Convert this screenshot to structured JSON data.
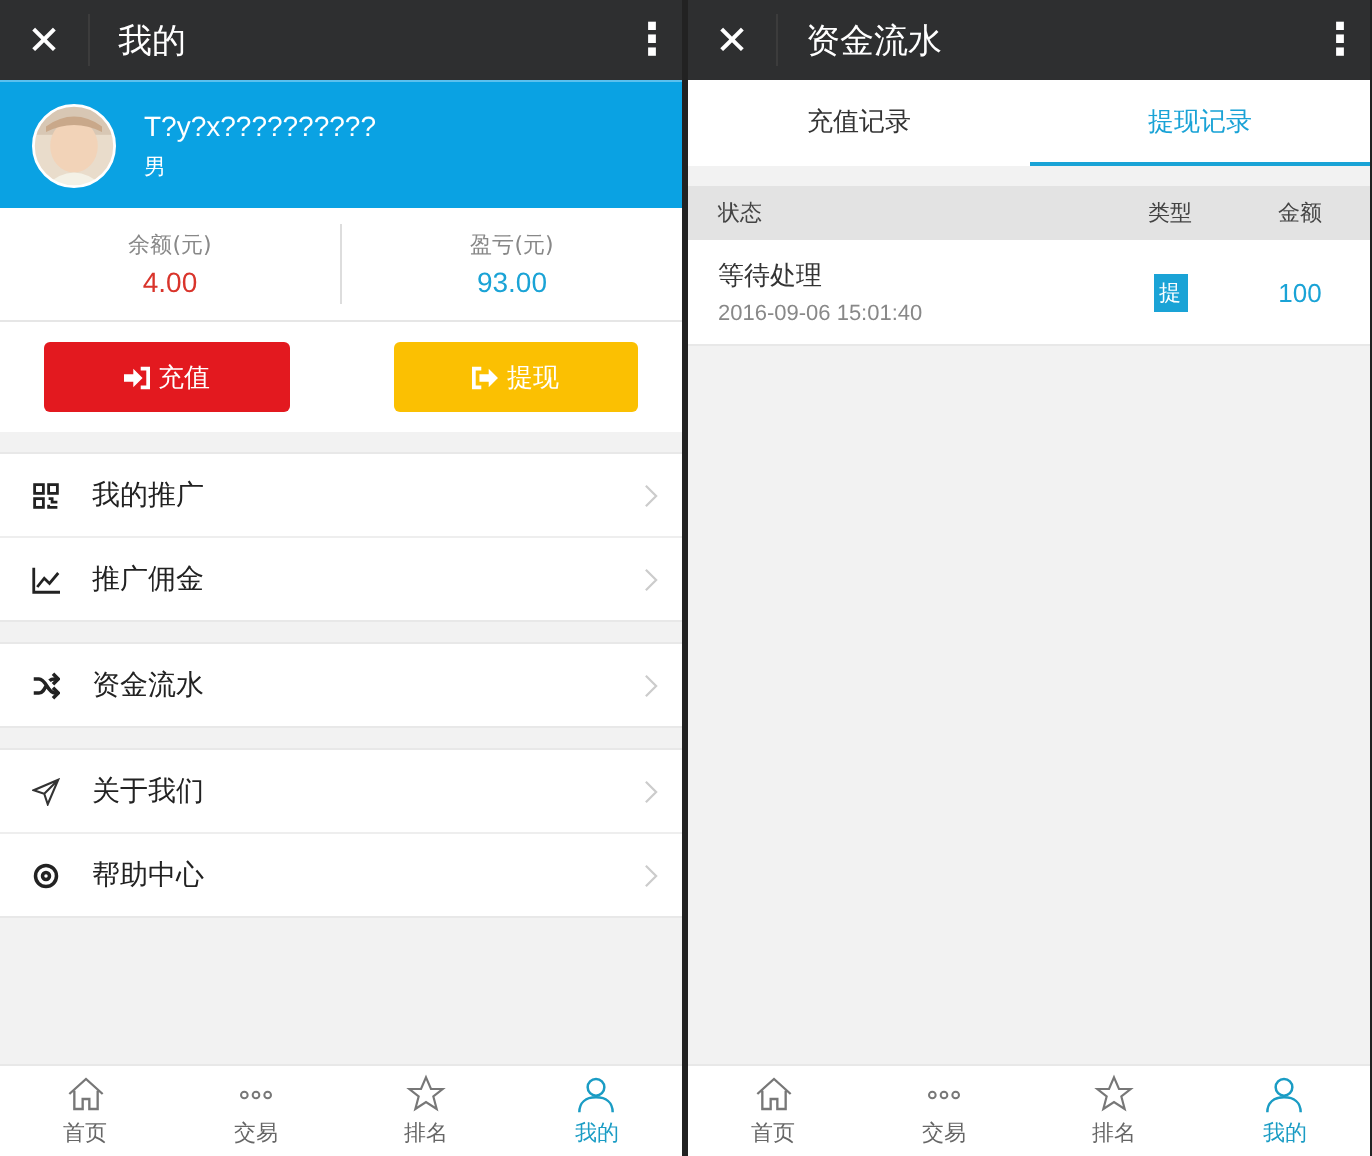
{
  "profile_screen": {
    "header": {
      "close": "✕",
      "title": "我的",
      "more": "⋮"
    },
    "user": {
      "name": "T?y?x??????????",
      "gender": "男"
    },
    "stats": [
      {
        "label": "余额(元)",
        "value": "4.00",
        "color": "#d9342b"
      },
      {
        "label": "盈亏(元)",
        "value": "93.00",
        "color": "#1aa3d6"
      }
    ],
    "buttons": [
      {
        "label": "充值",
        "kind": "deposit"
      },
      {
        "label": "提现",
        "kind": "withdraw"
      }
    ],
    "menu_groups": [
      [
        {
          "label": "我的推广",
          "kind": "qr"
        },
        {
          "label": "推广佣金",
          "kind": "chart"
        }
      ],
      [
        {
          "label": "资金流水",
          "kind": "shuffle"
        }
      ],
      [
        {
          "label": "关于我们",
          "kind": "send"
        },
        {
          "label": "帮助中心",
          "kind": "help"
        }
      ]
    ],
    "tabbar": [
      {
        "label": "首页",
        "kind": "home",
        "selected": false
      },
      {
        "label": "交易",
        "kind": "dots",
        "selected": false
      },
      {
        "label": "排名",
        "kind": "star",
        "selected": false
      },
      {
        "label": "我的",
        "kind": "user",
        "selected": true
      }
    ]
  },
  "funds_screen": {
    "header": {
      "close": "✕",
      "title": "资金流水",
      "more": "⋮"
    },
    "tabs": [
      {
        "label": "充值记录",
        "selected": false
      },
      {
        "label": "提现记录",
        "selected": true
      }
    ],
    "table": {
      "columns": [
        "状态",
        "类型",
        "金额"
      ],
      "rows": [
        {
          "status": "等待处理",
          "time": "2016-09-06 15:01:40",
          "type": "提",
          "amount": "100"
        }
      ]
    },
    "tabbar": [
      {
        "label": "首页",
        "kind": "home",
        "selected": false
      },
      {
        "label": "交易",
        "kind": "dots",
        "selected": false
      },
      {
        "label": "排名",
        "kind": "star",
        "selected": false
      },
      {
        "label": "我的",
        "kind": "user",
        "selected": true
      }
    ]
  }
}
